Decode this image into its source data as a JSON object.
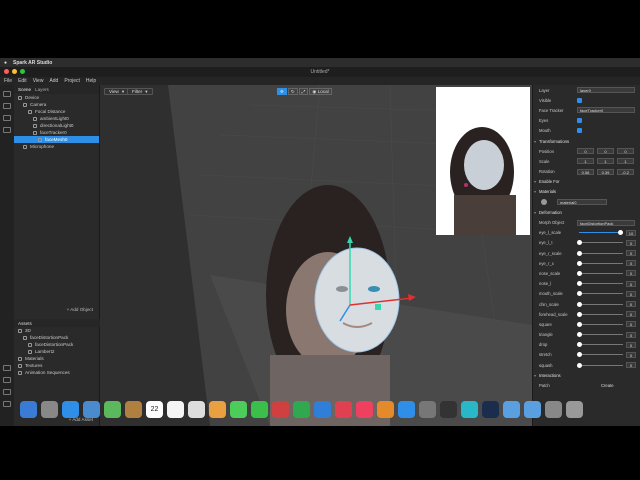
{
  "window": {
    "title": "Untitled*"
  },
  "menubar": {
    "app_name": "Spark AR Studio"
  },
  "menu": [
    "File",
    "Edit",
    "View",
    "Add",
    "Project",
    "Help"
  ],
  "scene": {
    "tab_scene": "Scene",
    "tab_layers": "Layers",
    "items": [
      {
        "label": "Device",
        "indent": 0
      },
      {
        "label": "Camera",
        "indent": 1
      },
      {
        "label": "Focal Distance",
        "indent": 2
      },
      {
        "label": "ambientLight0",
        "indent": 3
      },
      {
        "label": "directionalLight0",
        "indent": 3
      },
      {
        "label": "faceTracker0",
        "indent": 3
      },
      {
        "label": "faceMesh0",
        "indent": 4,
        "selected": true
      },
      {
        "label": "Microphone",
        "indent": 1
      }
    ],
    "add_object": "+ Add Object"
  },
  "assets": {
    "title": "Assets",
    "items": [
      {
        "label": "3D",
        "indent": 0
      },
      {
        "label": "faceDistortionPack",
        "indent": 1
      },
      {
        "label": "faceDistortionPack",
        "indent": 2
      },
      {
        "label": "Lambert2",
        "indent": 2
      },
      {
        "label": "Materials",
        "indent": 0
      },
      {
        "label": "Textures",
        "indent": 0
      },
      {
        "label": "Animation Sequences",
        "indent": 0
      }
    ],
    "add_asset": "+ Add Asset"
  },
  "viewport": {
    "view_button": "View",
    "filter_button": "Filter",
    "local_button": "Local"
  },
  "properties": {
    "layer_label": "Layer",
    "layer_value": "layer0",
    "visible_label": "Visible",
    "face_tracker_label": "Face Tracker",
    "face_tracker_value": "faceTracker0",
    "eyes_label": "Eyes",
    "mouth_label": "Mouth",
    "transformations_label": "Transformations",
    "position_label": "Position",
    "position": [
      "0",
      "0",
      "0"
    ],
    "scale_label": "Scale",
    "scale": [
      "1",
      "1",
      "1"
    ],
    "rotation_label": "Rotation",
    "rotation": [
      "0.58",
      "0.39",
      "-0.2"
    ],
    "enable_for_label": "Enable For",
    "materials_label": "Materials",
    "material_value": "material0",
    "deformation_label": "Deformation",
    "morph_object_label": "Morph Object",
    "morph_object_value": "faceDistortionPack",
    "deformation_rows": [
      {
        "label": "eye_l_scale",
        "value": 95,
        "display": "10"
      },
      {
        "label": "eye_l_t",
        "value": 0,
        "display": "0"
      },
      {
        "label": "eye_r_scale",
        "value": 0,
        "display": "0"
      },
      {
        "label": "eye_r_x",
        "value": 0,
        "display": "0"
      },
      {
        "label": "nose_scale",
        "value": 0,
        "display": "0"
      },
      {
        "label": "nose_l",
        "value": 0,
        "display": "0"
      },
      {
        "label": "mouth_scale",
        "value": 0,
        "display": "0"
      },
      {
        "label": "chin_scale",
        "value": 0,
        "display": "0"
      },
      {
        "label": "forehead_scale",
        "value": 0,
        "display": "0"
      },
      {
        "label": "square",
        "value": 0,
        "display": "0"
      },
      {
        "label": "triangle",
        "value": 0,
        "display": "0"
      },
      {
        "label": "drop",
        "value": 0,
        "display": "0"
      },
      {
        "label": "stretch",
        "value": 0,
        "display": "0"
      },
      {
        "label": "squash",
        "value": 0,
        "display": "0"
      }
    ],
    "interactions_label": "Interactions",
    "patch_label": "Patch",
    "create_button": "Create"
  },
  "colors": {
    "accent": "#2e8fe6",
    "panel": "#2a2a2a",
    "viewport": "#3c3c3c"
  },
  "dock_apps": [
    "finder-icon",
    "launchpad-icon",
    "safari-icon",
    "preview-icon",
    "maps-icon",
    "notes-book-icon",
    "calendar-icon",
    "notes-icon",
    "reminders-icon",
    "photos-icon",
    "messages-icon",
    "facetime-icon",
    "photo-booth-icon",
    "numbers-icon",
    "keynote-icon",
    "news-icon",
    "music-icon",
    "books-icon",
    "app-store-icon",
    "system-preferences-icon",
    "spark-ar-icon",
    "affinity-icon",
    "photoshop-icon",
    "folder-icon",
    "downloads-icon",
    "screenshots-icon",
    "trash-icon"
  ],
  "calendar_day": "22"
}
